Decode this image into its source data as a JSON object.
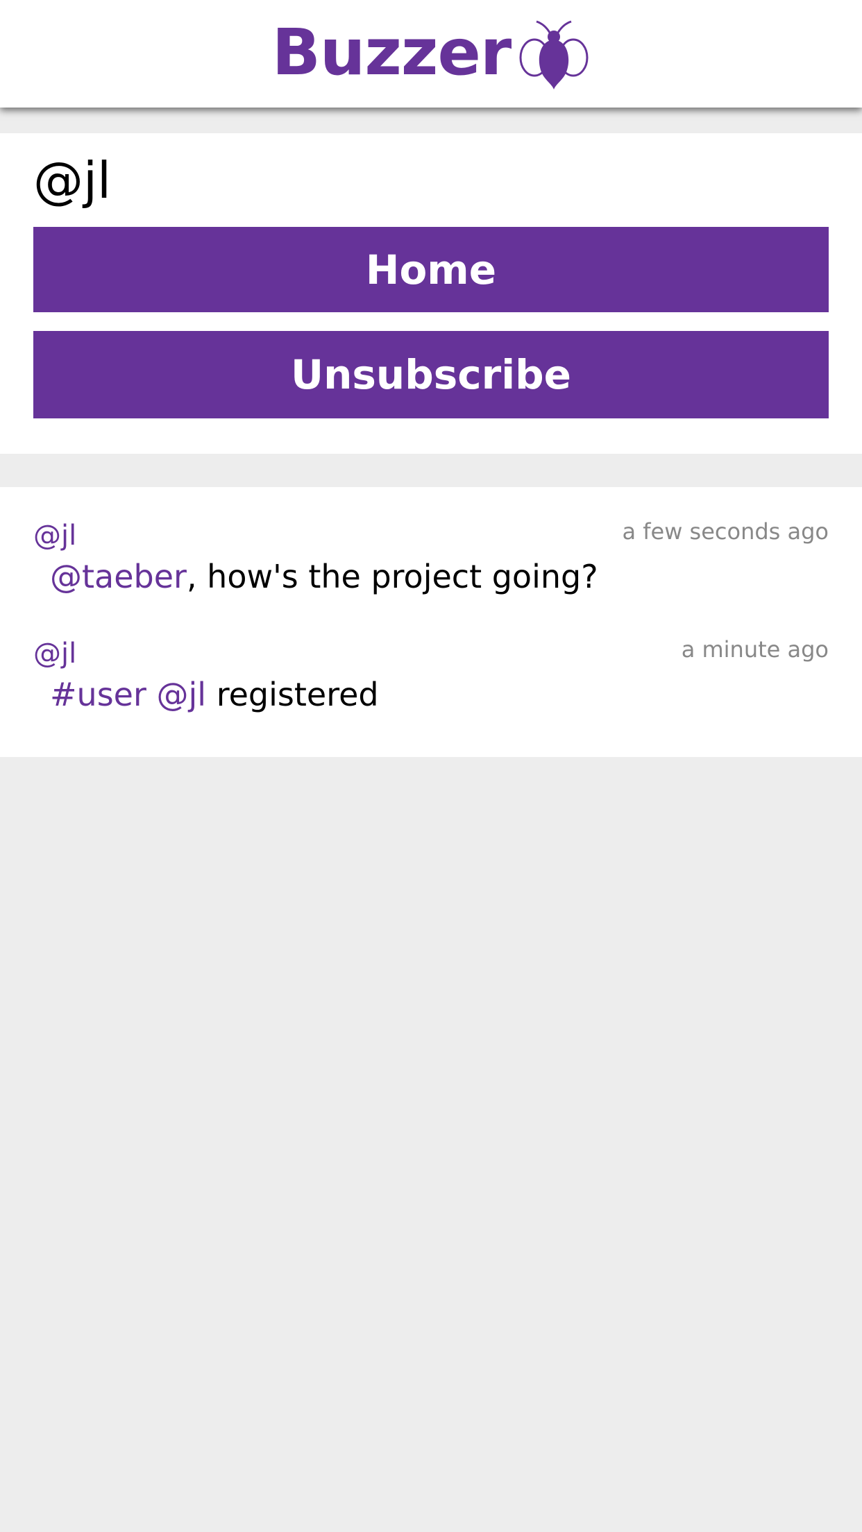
{
  "app": {
    "brand_name": "Buzzer",
    "brand_icon": "bee-icon",
    "accent_color": "#663399"
  },
  "profile": {
    "username": "@jl",
    "home_button": "Home",
    "unsubscribe_button": "Unsubscribe"
  },
  "feed": {
    "posts": [
      {
        "author": "@jl",
        "time": "a few seconds ago",
        "mention": "@taeber",
        "text": ", how's the project going?"
      },
      {
        "author": "@jl",
        "time": "a minute ago",
        "hashtag": "#user",
        "mention": "@jl",
        "text": "registered"
      }
    ]
  }
}
